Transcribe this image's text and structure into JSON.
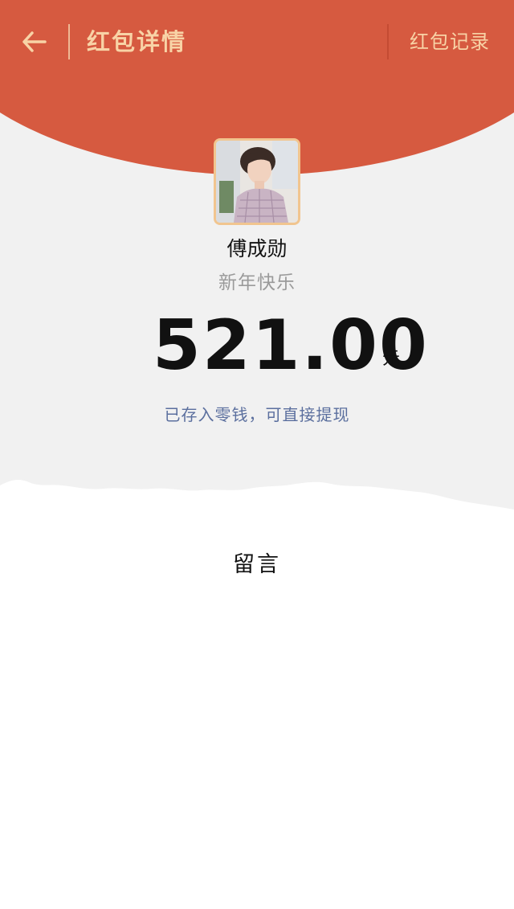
{
  "header": {
    "title": "红包详情",
    "records_label": "红包记录",
    "back_icon": "arrow-left-icon"
  },
  "sender": {
    "name": "傅成勋",
    "greeting": "新年快乐",
    "avatar_icon": "avatar"
  },
  "amount": {
    "value": "521.00",
    "currency": "元"
  },
  "status": {
    "note": "已存入零钱，可直接提现"
  },
  "message": {
    "label": "留言"
  },
  "colors": {
    "header_red": "#d65a40",
    "accent_gold": "#f8d3a6",
    "link_blue": "#5b6f9e",
    "background_gray": "#f1f1f1"
  }
}
